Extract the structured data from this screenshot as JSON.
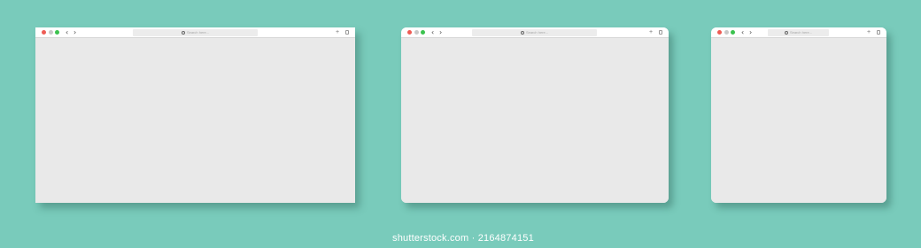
{
  "colors": {
    "background": "#79cbbb",
    "window_body": "#e9e9e9",
    "toolbar": "#ffffff",
    "close_dot": "#ee5c55",
    "minimize_dot": "#c9c9c9",
    "maximize_dot": "#3cc24f"
  },
  "windows": [
    {
      "nav": {
        "back": "‹",
        "forward": "›"
      },
      "search": {
        "placeholder": "Search here..."
      },
      "actions": {
        "new_tab": "+"
      }
    },
    {
      "nav": {
        "back": "‹",
        "forward": "›"
      },
      "search": {
        "placeholder": "Search here..."
      },
      "actions": {
        "new_tab": "+"
      }
    },
    {
      "nav": {
        "back": "‹",
        "forward": "›"
      },
      "search": {
        "placeholder": "Search here..."
      },
      "actions": {
        "new_tab": "+"
      }
    }
  ],
  "watermark": "shutterstock.com · 2164874151"
}
